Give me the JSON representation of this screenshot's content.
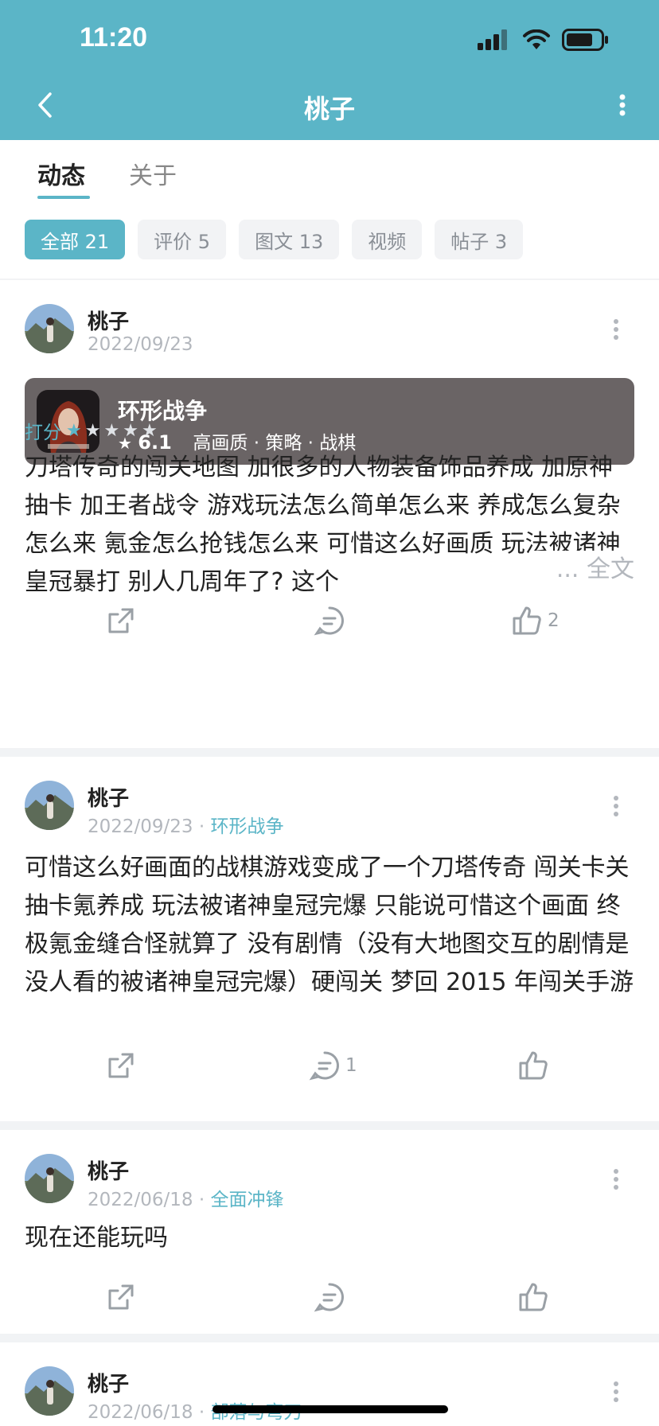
{
  "status_bar": {
    "time": "11:20"
  },
  "header": {
    "title": "桃子"
  },
  "tabs": [
    {
      "label": "动态"
    },
    {
      "label": "关于"
    }
  ],
  "filters": [
    {
      "label": "全部 21"
    },
    {
      "label": "评价 5"
    },
    {
      "label": "图文 13"
    },
    {
      "label": "视频"
    },
    {
      "label": "帖子 3"
    }
  ],
  "posts": [
    {
      "author": "桃子",
      "date": "2022/09/23",
      "game_card": {
        "name": "环形战争",
        "score": "6.1",
        "tags": "高画质 · 策略 · 战棋"
      },
      "rating_label": "打分",
      "rating_value": 1,
      "rating_max": 5,
      "text": "刀塔传奇的闯关地图 加很多的人物装备饰品养成 加原神抽卡 加王者战令 游戏玩法怎么简单怎么来 养成怎么复杂怎么来 氪金怎么抢钱怎么来 可惜这么好画质 玩法被诸神皇冠暴打 别人几周年了? 这个",
      "more_text": "... 全文",
      "likes": "2",
      "comments": ""
    },
    {
      "author": "桃子",
      "date": "2022/09/23",
      "game": "环形战争",
      "text": "可惜这么好画面的战棋游戏变成了一个刀塔传奇 闯关卡关抽卡氪养成 玩法被诸神皇冠完爆 只能说可惜这个画面 终极氪金缝合怪就算了 没有剧情（没有大地图交互的剧情是没人看的被诸神皇冠完爆）硬闯关 梦回 2015 年闯关手游",
      "comments": "1",
      "likes": ""
    },
    {
      "author": "桃子",
      "date": "2022/06/18",
      "game": "全面冲锋",
      "text": "现在还能玩吗",
      "comments": "",
      "likes": ""
    },
    {
      "author": "桃子",
      "date": "2022/06/18",
      "game": "部落与弯刀"
    }
  ],
  "colors": {
    "accent": "#5bb5c7",
    "card_bg": "#6a6465",
    "muted": "#b3b7bd"
  }
}
